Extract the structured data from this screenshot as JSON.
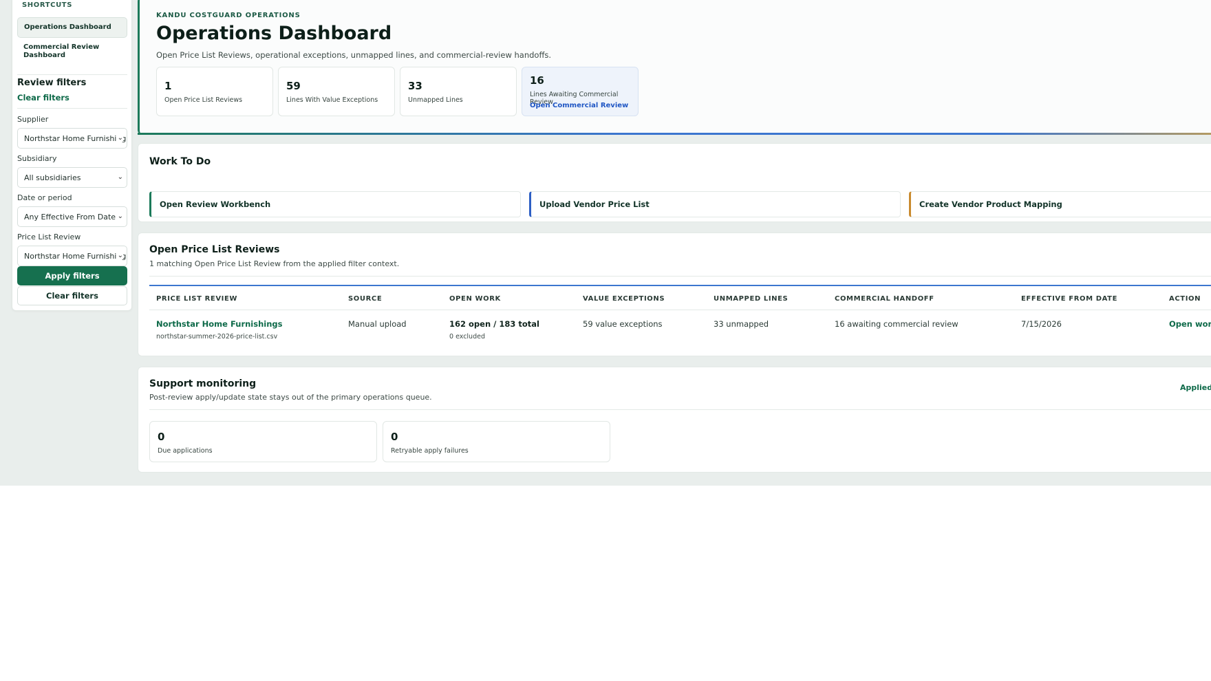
{
  "sidebar": {
    "shortcuts_heading": "SHORTCUTS",
    "links": [
      {
        "label": "Operations Dashboard",
        "active": true
      },
      {
        "label": "Commercial Review Dashboard",
        "active": false
      }
    ],
    "filters_title": "Review filters",
    "clear_link": "Clear filters",
    "supplier": {
      "label": "Supplier",
      "value": "Northstar Home Furnishings"
    },
    "subsidiary": {
      "label": "Subsidiary",
      "value": "All subsidiaries"
    },
    "date": {
      "label": "Date or period",
      "value": "Any Effective From Date"
    },
    "review": {
      "label": "Price List Review",
      "value": "Northstar Home Furnishings"
    },
    "apply_button": "Apply filters",
    "clear_button": "Clear filters"
  },
  "hero": {
    "eyebrow": "KANDU COSTGUARD OPERATIONS",
    "title": "Operations Dashboard",
    "subtitle": "Open Price List Reviews, operational exceptions, unmapped lines, and commercial-review handoffs.",
    "stats": [
      {
        "value": "1",
        "label": "Open Price List Reviews"
      },
      {
        "value": "59",
        "label": "Lines With Value Exceptions"
      },
      {
        "value": "33",
        "label": "Unmapped Lines"
      },
      {
        "value": "16",
        "label": "Lines Awaiting Commercial Review",
        "action": "Open Commercial Review"
      }
    ]
  },
  "todo": {
    "title": "Work To Do",
    "items": [
      "Open Review Workbench",
      "Upload Vendor Price List",
      "Create Vendor Product Mapping"
    ]
  },
  "reviews": {
    "title": "Open Price List Reviews",
    "subtitle": "1 matching Open Price List Review from the applied filter context.",
    "columns": [
      "PRICE LIST REVIEW",
      "SOURCE",
      "OPEN WORK",
      "VALUE EXCEPTIONS",
      "UNMAPPED LINES",
      "COMMERCIAL HANDOFF",
      "EFFECTIVE FROM DATE",
      "ACTION"
    ],
    "rows": [
      {
        "name": "Northstar Home Furnishings",
        "file": "northstar-summer-2026-price-list.csv",
        "source": "Manual upload",
        "open_work": "162 open / 183 total",
        "excluded": "0 excluded",
        "value_exceptions": "59 value exceptions",
        "unmapped": "33 unmapped",
        "handoff": "16 awaiting commercial review",
        "effective": "7/15/2026",
        "action": "Open work"
      }
    ]
  },
  "monitoring": {
    "title": "Support monitoring",
    "subtitle": "Post-review apply/update state stays out of the primary operations queue.",
    "applied_link": "Applied",
    "cards": [
      {
        "value": "0",
        "label": "Due applications"
      },
      {
        "value": "0",
        "label": "Retryable apply failures"
      }
    ]
  }
}
